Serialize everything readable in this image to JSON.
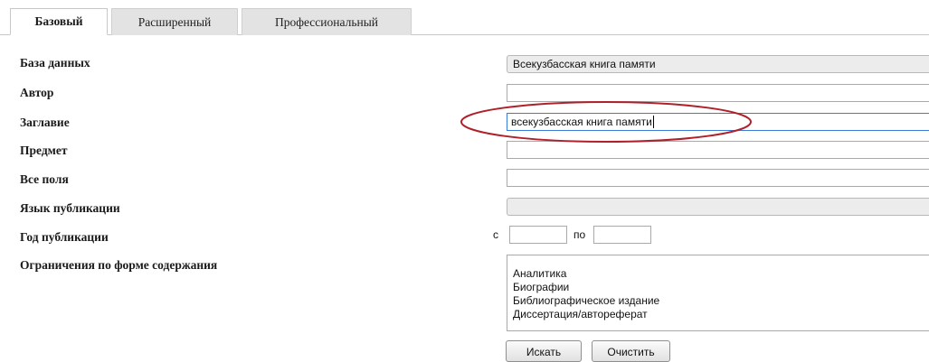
{
  "tabs": [
    {
      "label": "Базовый",
      "active": true
    },
    {
      "label": "Расширенный",
      "active": false
    },
    {
      "label": "Профессиональный",
      "active": false
    }
  ],
  "form": {
    "database": {
      "label": "База данных",
      "value": "Всекузбасская книга памяти"
    },
    "author": {
      "label": "Автор",
      "value": ""
    },
    "title": {
      "label": "Заглавие",
      "value": "всекузбасская книга памяти"
    },
    "subject": {
      "label": "Предмет",
      "value": ""
    },
    "all_fields": {
      "label": "Все поля",
      "value": ""
    },
    "language": {
      "label": "Язык публикации",
      "value": ""
    },
    "year": {
      "label": "Год публикации",
      "from_label": "с",
      "to_label": "по",
      "from_value": "",
      "to_value": ""
    },
    "content_form": {
      "label": "Ограничения по форме содержания",
      "options": [
        "Аналитика",
        "Биографии",
        "Библиографическое издание",
        "Диссертация/автореферат"
      ]
    }
  },
  "buttons": {
    "search": "Искать",
    "clear": "Очистить"
  },
  "colors": {
    "highlight_ellipse": "#b0202a",
    "focus_border": "#3a7bd5",
    "tab_inactive": "#e3e3e3"
  }
}
